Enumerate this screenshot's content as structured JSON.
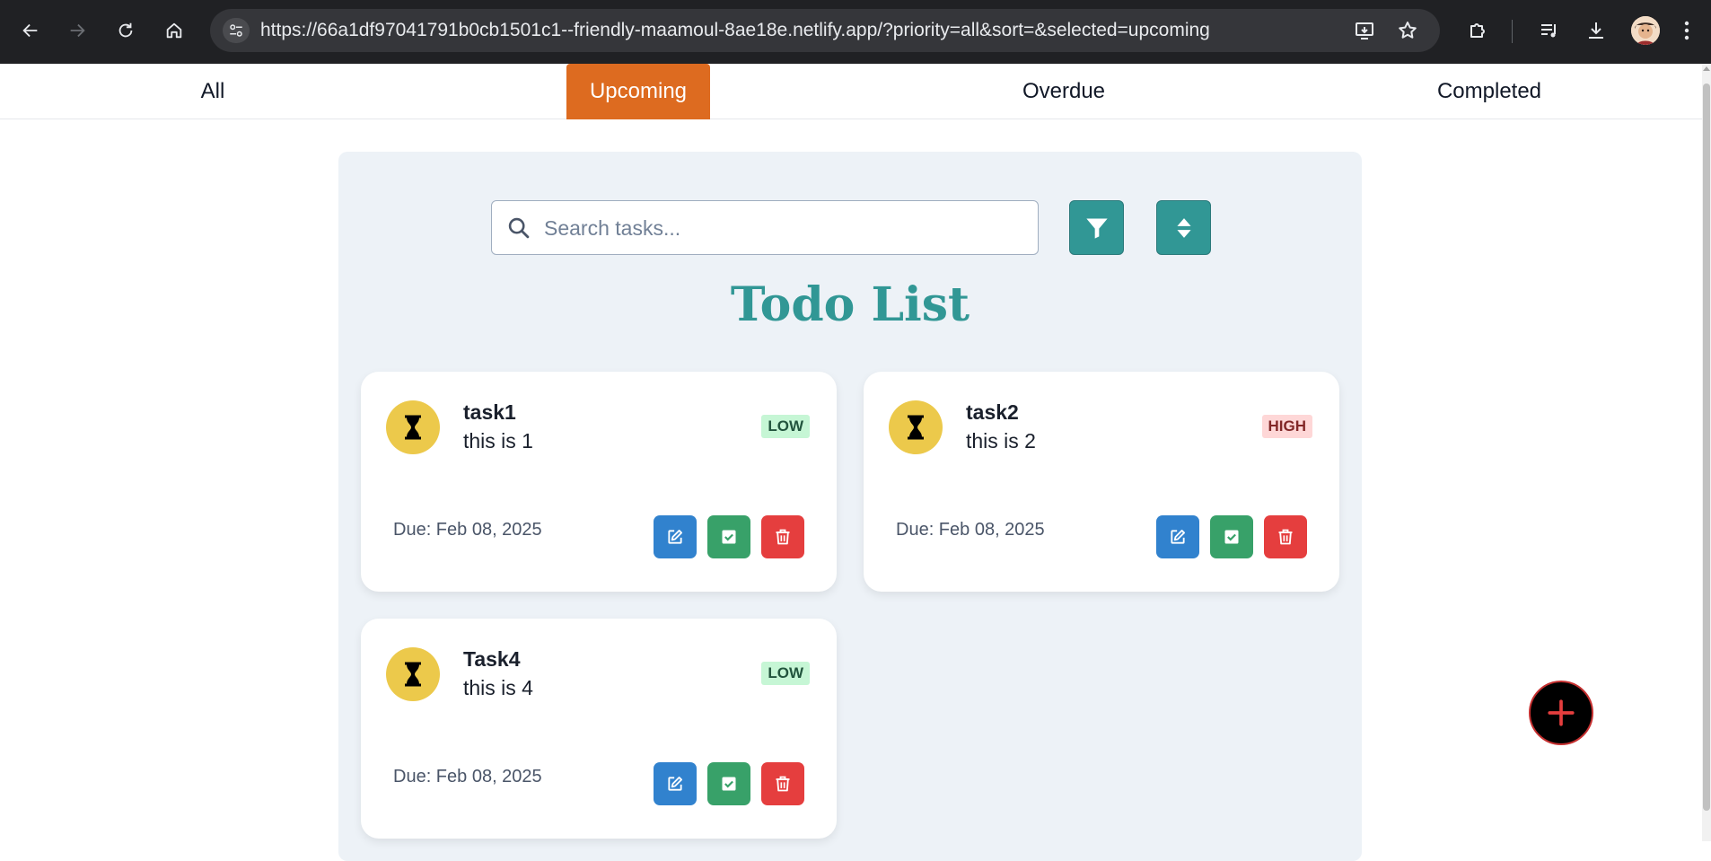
{
  "browser": {
    "url": "https://66a1df97041791b0cb1501c1--friendly-maamoul-8ae18e.netlify.app/?priority=all&sort=&selected=upcoming",
    "icons": [
      "back-icon",
      "forward-icon",
      "reload-icon",
      "home-icon",
      "site-info-icon",
      "install-icon",
      "star-icon",
      "extensions-icon",
      "media-icon",
      "download-icon",
      "avatar",
      "menu-icon"
    ]
  },
  "tabs": [
    {
      "label": "All",
      "active": false
    },
    {
      "label": "Upcoming",
      "active": true
    },
    {
      "label": "Overdue",
      "active": false
    },
    {
      "label": "Completed",
      "active": false
    }
  ],
  "search": {
    "placeholder": "Search tasks..."
  },
  "heading": "Todo List",
  "tasks": [
    {
      "title": "task1",
      "description": "this is 1",
      "priority": "LOW",
      "due": "Due: Feb 08, 2025",
      "status_icon": "hourglass-icon"
    },
    {
      "title": "task2",
      "description": "this is 2",
      "priority": "HIGH",
      "due": "Due: Feb 08, 2025",
      "status_icon": "hourglass-icon"
    },
    {
      "title": "Task4",
      "description": "this is 4",
      "priority": "LOW",
      "due": "Due: Feb 08, 2025",
      "status_icon": "hourglass-icon"
    }
  ],
  "colors": {
    "accent": "#319795",
    "active_tab": "#dd6b20",
    "edit": "#3182ce",
    "complete": "#38a169",
    "delete": "#e53e3e",
    "status_pending": "#ecc94b",
    "fab": "#000000",
    "fab_plus": "#e53e3e"
  }
}
